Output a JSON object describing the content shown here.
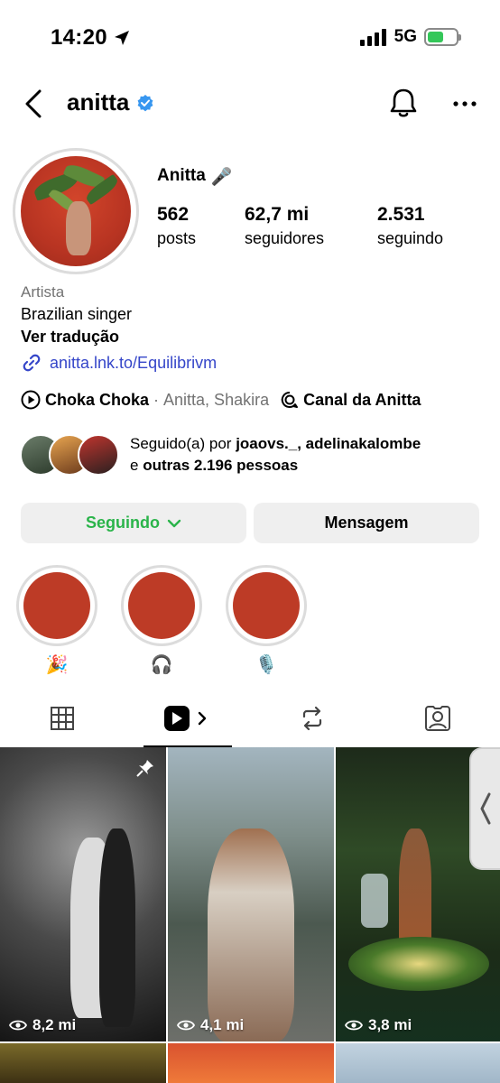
{
  "status_bar": {
    "time": "14:20",
    "network": "5G"
  },
  "header": {
    "username": "anitta"
  },
  "profile": {
    "display_name": "Anitta",
    "name_emoji": "🎤",
    "stats": [
      {
        "value": "562",
        "label": "posts"
      },
      {
        "value": "62,7 mi",
        "label": "seguidores"
      },
      {
        "value": "2.531",
        "label": "seguindo"
      }
    ],
    "category": "Artista",
    "bio": "Brazilian singer",
    "translate": "Ver tradução",
    "link": "anitta.lnk.to/Equilibrivm"
  },
  "music": {
    "song": "Choka Choka",
    "separator": "·",
    "artists": "Anitta, Shakira",
    "channel": "Canal da Anitta"
  },
  "followed_by": {
    "prefix": "Seguido(a) por",
    "names": "joaovs._, adelinakalombe",
    "middle": "e",
    "others": "outras 2.196 pessoas"
  },
  "buttons": {
    "following": "Seguindo",
    "message": "Mensagem"
  },
  "highlights": [
    {
      "label": "🎉"
    },
    {
      "label": "🎧"
    },
    {
      "label": "🎙️"
    }
  ],
  "posts": [
    {
      "views": "8,2 mi"
    },
    {
      "views": "4,1 mi"
    },
    {
      "views": "3,8 mi"
    }
  ],
  "colors": {
    "accent_green": "#2ab44a",
    "link_blue": "#3546c9",
    "verified_blue": "#3897f0"
  }
}
